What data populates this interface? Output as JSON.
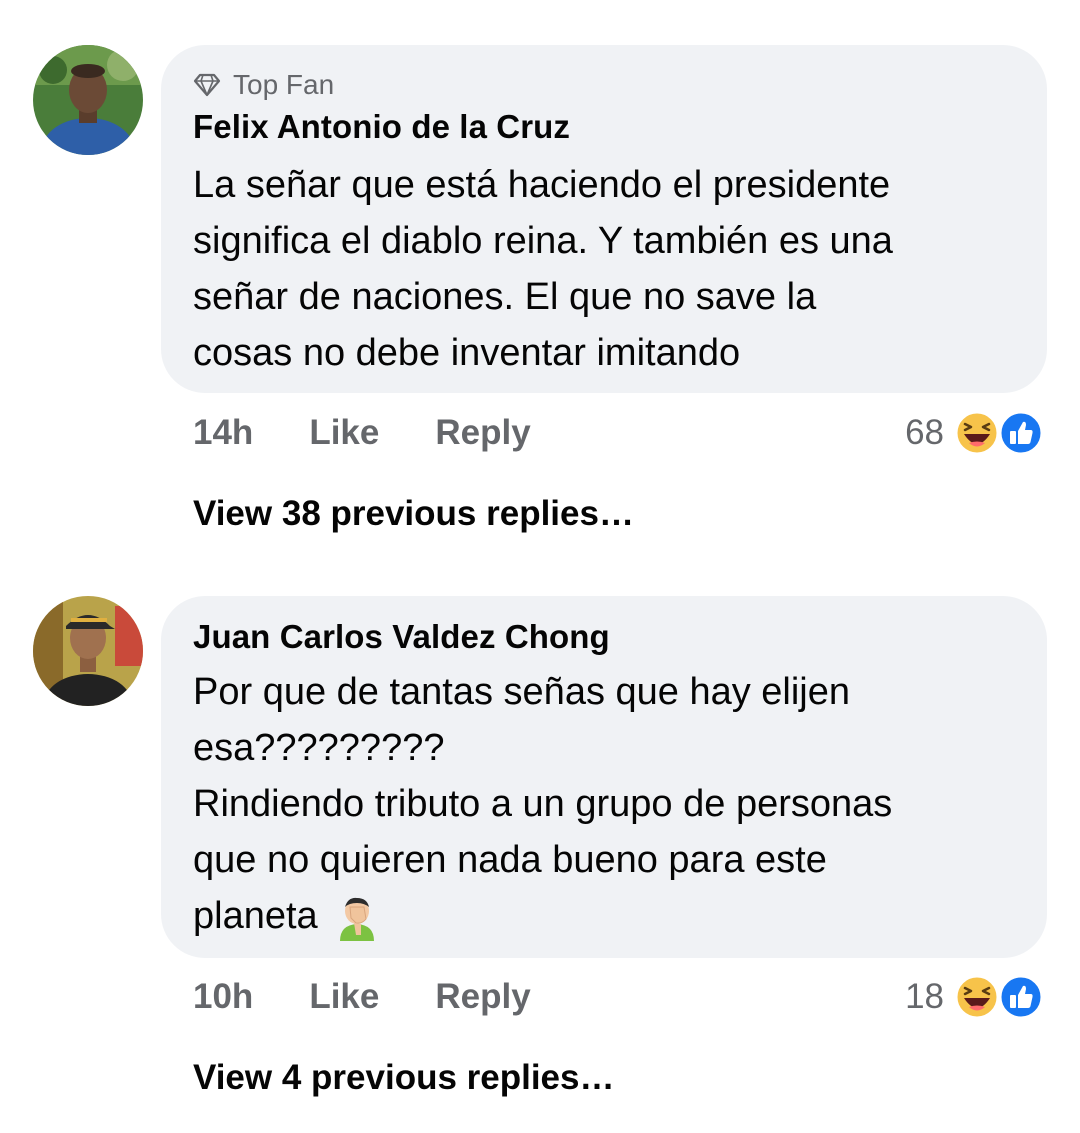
{
  "comments": [
    {
      "badge": "Top Fan",
      "author": "Felix Antonio de la Cruz",
      "text_lines": [
        "La señar que está haciendo el presidente",
        "significa el diablo reina. Y también es una",
        "señar de naciones. El que no save la",
        "cosas no debe inventar imitando"
      ],
      "time": "14h",
      "like_label": "Like",
      "reply_label": "Reply",
      "reaction_count": "68",
      "reaction_icons": [
        "haha-icon",
        "like-icon"
      ],
      "view_replies": "View 38 previous replies…",
      "avatar_colors": {
        "bg": "#4a7d3a",
        "shirt": "#2e5fa8",
        "skin": "#6b4a36"
      }
    },
    {
      "author": "Juan Carlos Valdez Chong",
      "text_lines": [
        "Por que de tantas señas que hay elijen",
        "esa?????????",
        "Rindiendo tributo a un grupo de personas",
        "que no quieren nada bueno para este",
        "planeta"
      ],
      "emoji": "facepalm-emoji",
      "time": "10h",
      "like_label": "Like",
      "reply_label": "Reply",
      "reaction_count": "18",
      "reaction_icons": [
        "haha-icon",
        "like-icon"
      ],
      "view_replies": "View 4 previous replies…",
      "avatar_colors": {
        "bg": "#b9a34a",
        "shirt": "#222222",
        "skin": "#a0714f"
      }
    }
  ],
  "colors": {
    "bubble": "#f0f2f5",
    "secondary_text": "#65676b",
    "like_blue": "#1877f2",
    "haha_yellow": "#f7c34a"
  }
}
